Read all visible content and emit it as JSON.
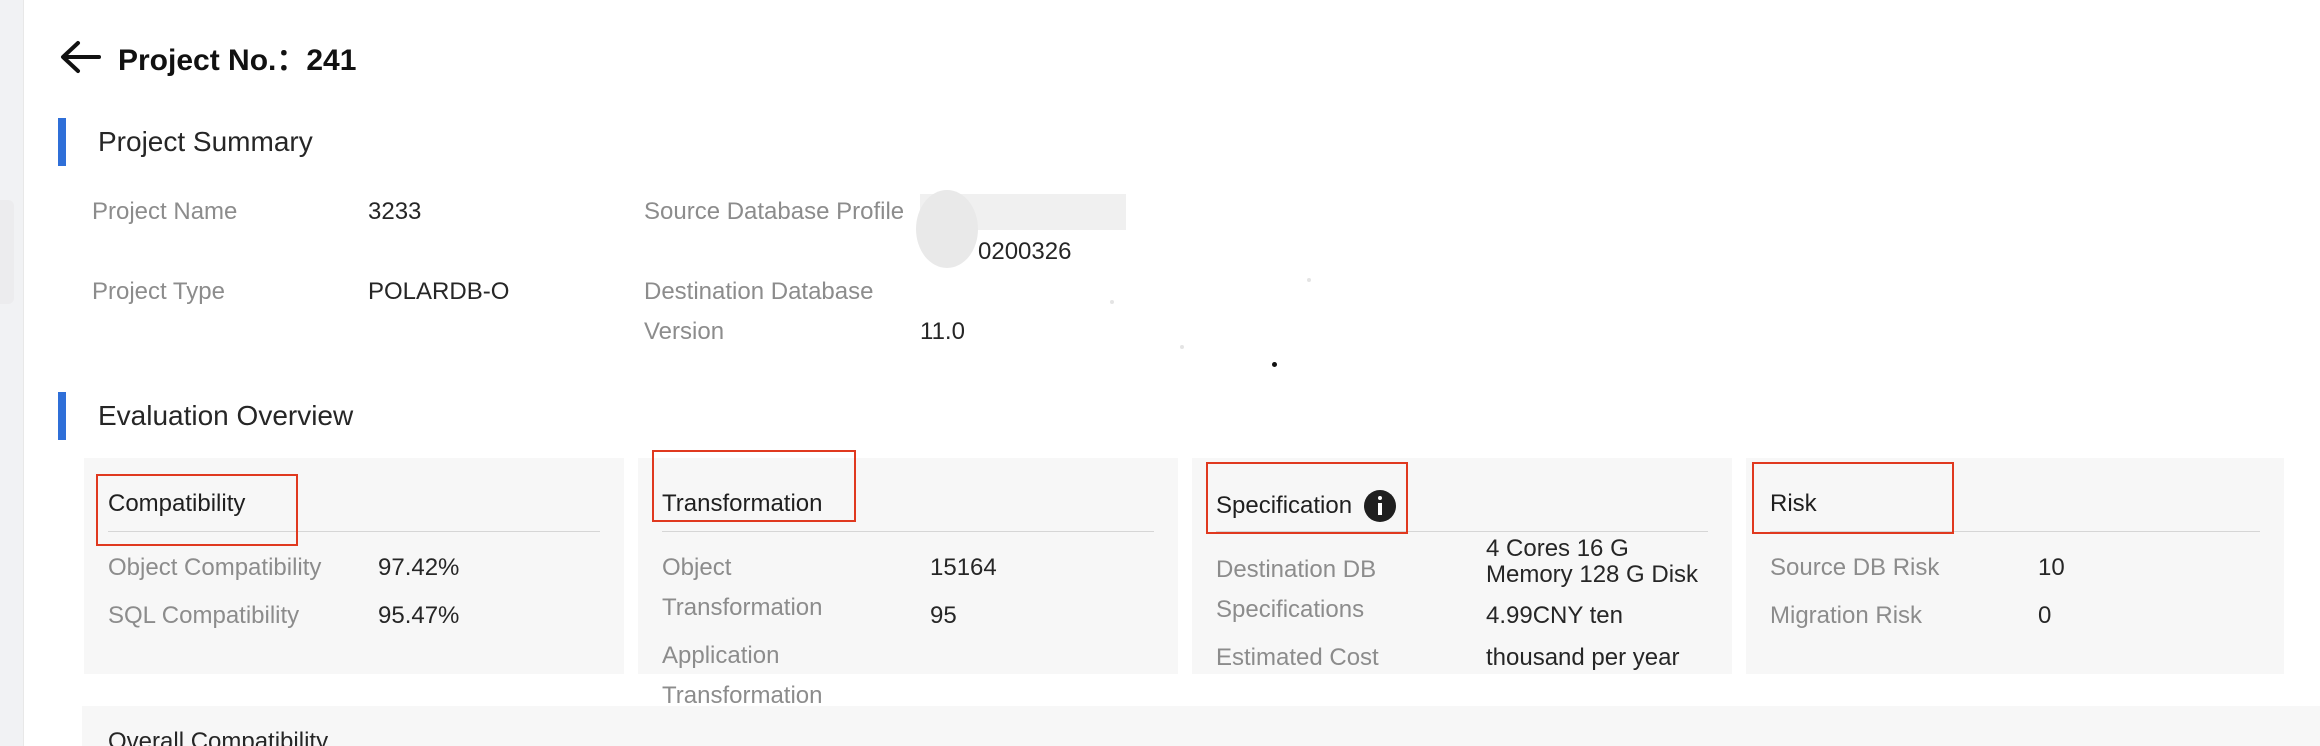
{
  "header": {
    "title": "Project No.：241"
  },
  "summary": {
    "heading": "Project Summary",
    "project_name_label": "Project Name",
    "project_name_value": "3233",
    "project_type_label": "Project Type",
    "project_type_value": "POLARDB-O",
    "source_db_profile_label": "Source Database Profile",
    "source_db_profile_value_visible": "",
    "source_db_profile_value_line2": "0200326",
    "dest_db_version_label_line1": "Destination Database",
    "dest_db_version_label_line2": "Version",
    "dest_db_version_value": "11.0"
  },
  "overview": {
    "heading": "Evaluation Overview",
    "cards": [
      {
        "title": "Compatibility",
        "rows": [
          {
            "label": "Object Compatibility",
            "value": "97.42%"
          },
          {
            "label": "SQL Compatibility",
            "value": "95.47%"
          }
        ]
      },
      {
        "title": "Transformation",
        "rows": [
          {
            "label_line1": "Object",
            "label_line2": "Transformation",
            "value": "15164"
          },
          {
            "label_line1": "Application",
            "label_line2": "Transformation",
            "value": "95"
          }
        ]
      },
      {
        "title": "Specification",
        "icon": "info-icon",
        "rows": [
          {
            "label_line1": "Destination DB",
            "label_line2": "Specifications",
            "value_line1": "4 Cores 16 G",
            "value_line2": "Memory 128 G Disk"
          },
          {
            "label": "Estimated Cost",
            "value_line1": "4.99CNY ten",
            "value_line2": "thousand per year"
          }
        ]
      },
      {
        "title": "Risk",
        "rows": [
          {
            "label": "Source DB Risk",
            "value": "10"
          },
          {
            "label": "Migration Risk",
            "value": "0"
          }
        ]
      }
    ]
  },
  "bottom": {
    "label": "Overall Compatibility"
  },
  "colors": {
    "accent_bar": "#2f6fd8",
    "highlight_box": "#e0391f",
    "card_bg": "#f7f7f7"
  }
}
